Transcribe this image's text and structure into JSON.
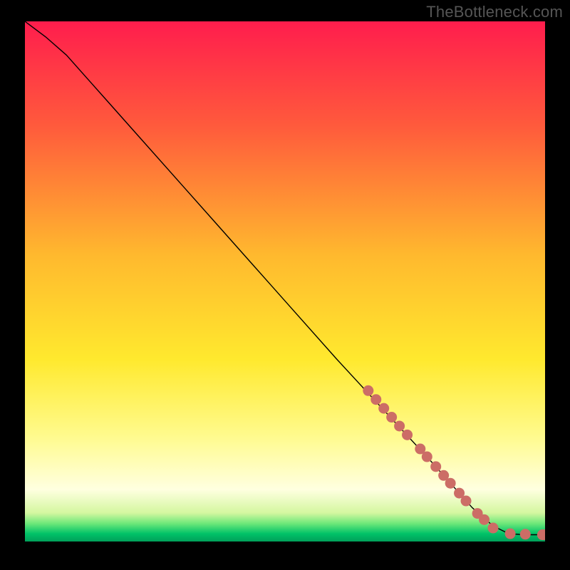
{
  "watermark": "TheBottleneck.com",
  "chart_data": {
    "type": "line",
    "title": "",
    "xlabel": "",
    "ylabel": "",
    "xlim": [
      0,
      100
    ],
    "ylim": [
      0,
      100
    ],
    "grid": false,
    "legend": false,
    "background_gradient": {
      "stops": [
        {
          "pos": 0.0,
          "color": "#ff1d4d"
        },
        {
          "pos": 0.2,
          "color": "#ff5a3c"
        },
        {
          "pos": 0.45,
          "color": "#ffb92e"
        },
        {
          "pos": 0.65,
          "color": "#ffe92e"
        },
        {
          "pos": 0.8,
          "color": "#fffb8f"
        },
        {
          "pos": 0.9,
          "color": "#ffffe0"
        },
        {
          "pos": 0.945,
          "color": "#d4f7a0"
        },
        {
          "pos": 0.965,
          "color": "#6fe87a"
        },
        {
          "pos": 0.985,
          "color": "#00c268"
        },
        {
          "pos": 1.0,
          "color": "#00a05a"
        }
      ]
    },
    "series": [
      {
        "name": "curve",
        "stroke": "#000000",
        "stroke_width": 1.4,
        "points": [
          {
            "x": 0,
            "y": 100
          },
          {
            "x": 4,
            "y": 97
          },
          {
            "x": 8,
            "y": 93.5
          },
          {
            "x": 12,
            "y": 89
          },
          {
            "x": 16,
            "y": 84.5
          },
          {
            "x": 20,
            "y": 80
          },
          {
            "x": 28,
            "y": 71
          },
          {
            "x": 36,
            "y": 62
          },
          {
            "x": 44,
            "y": 53
          },
          {
            "x": 52,
            "y": 44
          },
          {
            "x": 60,
            "y": 35
          },
          {
            "x": 66,
            "y": 28.5
          },
          {
            "x": 72,
            "y": 22
          },
          {
            "x": 78,
            "y": 15.5
          },
          {
            "x": 82,
            "y": 11
          },
          {
            "x": 86,
            "y": 6.5
          },
          {
            "x": 90,
            "y": 3
          },
          {
            "x": 93,
            "y": 1.5
          },
          {
            "x": 96,
            "y": 1.3
          },
          {
            "x": 100,
            "y": 1.3
          }
        ]
      }
    ],
    "markers": {
      "name": "points",
      "color": "#cc6d66",
      "radius": 7.5,
      "points": [
        {
          "x": 66,
          "y": 29
        },
        {
          "x": 67.5,
          "y": 27.3
        },
        {
          "x": 69,
          "y": 25.6
        },
        {
          "x": 70.5,
          "y": 23.9
        },
        {
          "x": 72,
          "y": 22.2
        },
        {
          "x": 73.5,
          "y": 20.5
        },
        {
          "x": 76,
          "y": 17.8
        },
        {
          "x": 77.3,
          "y": 16.3
        },
        {
          "x": 79,
          "y": 14.4
        },
        {
          "x": 80.5,
          "y": 12.7
        },
        {
          "x": 81.8,
          "y": 11.2
        },
        {
          "x": 83.5,
          "y": 9.3
        },
        {
          "x": 84.8,
          "y": 7.8
        },
        {
          "x": 87,
          "y": 5.4
        },
        {
          "x": 88.3,
          "y": 4.2
        },
        {
          "x": 90,
          "y": 2.6
        },
        {
          "x": 93.3,
          "y": 1.5
        },
        {
          "x": 96.2,
          "y": 1.4
        },
        {
          "x": 99.5,
          "y": 1.3
        },
        {
          "x": 100,
          "y": 1.3
        }
      ]
    }
  }
}
